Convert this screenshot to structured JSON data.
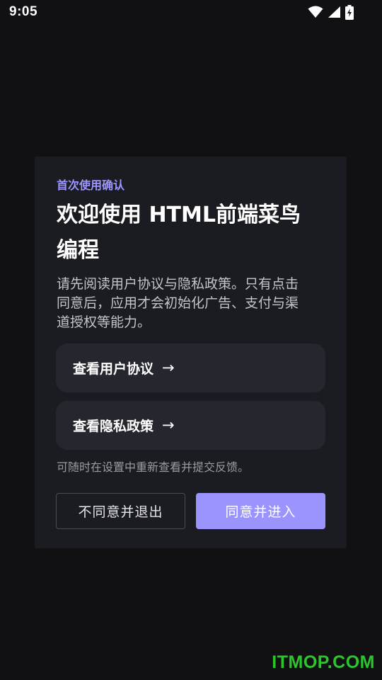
{
  "status_bar": {
    "time": "9:05",
    "icons": [
      "wifi-icon",
      "cellular-signal-icon",
      "battery-charging-icon"
    ]
  },
  "dialog": {
    "eyebrow": "首次使用确认",
    "title_lines": [
      "欢迎使用 HTML前端菜鸟",
      "编程"
    ],
    "description_lines": [
      "请先阅读用户协议与隐私政策。只有点击",
      "同意后，应用才会初始化广告、支付与渠",
      "道授权等能力。"
    ],
    "links": {
      "terms_label": "查看用户协议",
      "privacy_label": "查看隐私政策",
      "arrow": "→"
    },
    "note": "可随时在设置中重新查看并提交反馈。",
    "buttons": {
      "decline_label": "不同意并退出",
      "accept_label": "同意并进入"
    }
  },
  "watermark": "ITMOP.COM",
  "colors": {
    "background": "#111114",
    "card": "#1b1c21",
    "accent": "#9b94ff",
    "link_button": "#26272e",
    "watermark": "#2dc52d"
  }
}
